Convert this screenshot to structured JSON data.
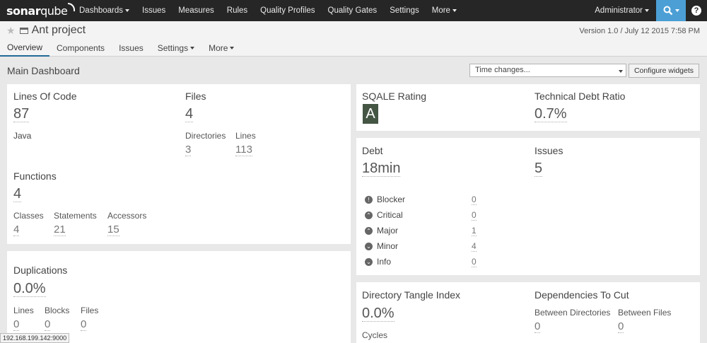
{
  "brand": {
    "logo_prefix": "sonar",
    "logo_suffix": "qube"
  },
  "nav": {
    "items": [
      "Dashboards",
      "Issues",
      "Measures",
      "Rules",
      "Quality Profiles",
      "Quality Gates",
      "Settings",
      "More"
    ],
    "user": "Administrator",
    "search_icon": "search-icon",
    "help_label": "?"
  },
  "project": {
    "name": "Ant project",
    "version": "Version 1.0 / July 12 2015 7:58 PM",
    "tabs": [
      "Overview",
      "Components",
      "Issues",
      "Settings",
      "More"
    ]
  },
  "dashboard": {
    "title": "Main Dashboard",
    "time_select": "Time changes...",
    "configure_label": "Configure widgets"
  },
  "size_widget": {
    "loc_label": "Lines Of Code",
    "loc_value": "87",
    "language": "Java",
    "files_label": "Files",
    "files_value": "4",
    "dirs_label": "Directories",
    "dirs_value": "3",
    "lines_label": "Lines",
    "lines_value": "113",
    "functions_label": "Functions",
    "functions_value": "4",
    "classes_label": "Classes",
    "classes_value": "4",
    "statements_label": "Statements",
    "statements_value": "21",
    "accessors_label": "Accessors",
    "accessors_value": "15"
  },
  "dup_widget": {
    "label": "Duplications",
    "value": "0.0%",
    "lines_label": "Lines",
    "lines_value": "0",
    "blocks_label": "Blocks",
    "blocks_value": "0",
    "files_label": "Files",
    "files_value": "0"
  },
  "sqale_widget": {
    "rating_label": "SQALE Rating",
    "rating_value": "A",
    "ratio_label": "Technical Debt Ratio",
    "ratio_value": "0.7%"
  },
  "debt_widget": {
    "debt_label": "Debt",
    "debt_value": "18min",
    "issues_label": "Issues",
    "issues_value": "5",
    "severities": [
      {
        "name": "Blocker",
        "count": "0",
        "icon": "blocker-icon"
      },
      {
        "name": "Critical",
        "count": "0",
        "icon": "critical-icon"
      },
      {
        "name": "Major",
        "count": "1",
        "icon": "major-icon"
      },
      {
        "name": "Minor",
        "count": "4",
        "icon": "minor-icon"
      },
      {
        "name": "Info",
        "count": "0",
        "icon": "info-icon"
      }
    ]
  },
  "tangle_widget": {
    "label": "Directory Tangle Index",
    "value": "0.0%",
    "cycles_label": "Cycles",
    "deps_label": "Dependencies To Cut",
    "between_dirs_label": "Between Directories",
    "between_dirs_value": "0",
    "between_files_label": "Between Files",
    "between_files_value": "0"
  },
  "status_bar": {
    "url": "192.168.199.142:9000"
  },
  "colors": {
    "nav_bg": "#262626",
    "search_bg": "#4b9fd5",
    "rating_bg": "#445544",
    "active_tab": "#236a97"
  }
}
